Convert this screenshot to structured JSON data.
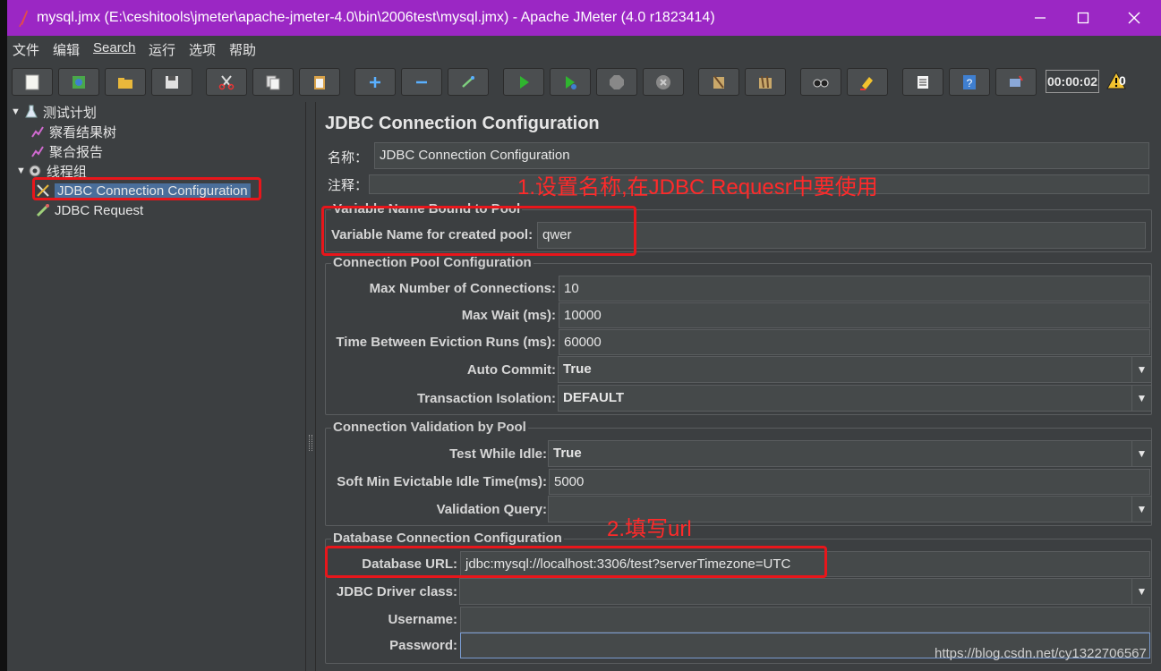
{
  "window": {
    "title": "mysql.jmx (E:\\ceshitools\\jmeter\\apache-jmeter-4.0\\bin\\2006test\\mysql.jmx) - Apache JMeter (4.0 r1823414)",
    "colors": {
      "titlebar": "#9b27c4",
      "background": "#3c3f41",
      "annotation": "#e8161b"
    }
  },
  "menu": [
    "文件",
    "编辑",
    "Search",
    "运行",
    "选项",
    "帮助"
  ],
  "toolbar": {
    "icons": [
      "new-icon",
      "templates-icon",
      "open-icon",
      "save-icon",
      "cut-icon",
      "copy-icon",
      "paste-icon",
      "expand-icon",
      "collapse-icon",
      "toggle-icon",
      "start-icon",
      "start-no-pause-icon",
      "stop-icon",
      "shutdown-icon",
      "clear-icon",
      "clear-all-icon",
      "search-icon",
      "reset-search-icon",
      "function-helper-icon",
      "help-icon",
      "remote-icon"
    ],
    "timer": "00:00:02",
    "warning_count": "0"
  },
  "tree": {
    "items": [
      {
        "label": "测试计划",
        "icon": "test-plan-icon"
      },
      {
        "label": "察看结果树",
        "icon": "listener-icon"
      },
      {
        "label": "聚合报告",
        "icon": "listener-icon"
      },
      {
        "label": "线程组",
        "icon": "thread-group-icon"
      },
      {
        "label": "JDBC Connection Configuration",
        "icon": "config-icon",
        "selected": true
      },
      {
        "label": "JDBC Request",
        "icon": "sampler-icon"
      }
    ]
  },
  "form": {
    "heading": "JDBC Connection Configuration",
    "name_label": "名称：",
    "name_value": "JDBC Connection Configuration",
    "comment_label": "注释：",
    "comment_value": "",
    "var_group_title": "Variable Name Bound to Pool",
    "var_label": "Variable Name for created pool:",
    "var_value": "qwer",
    "pool_group_title": "Connection Pool Configuration",
    "max_conn_label": "Max Number of Connections:",
    "max_conn_value": "10",
    "max_wait_label": "Max Wait (ms):",
    "max_wait_value": "10000",
    "eviction_label": "Time Between Eviction Runs (ms):",
    "eviction_value": "60000",
    "auto_commit_label": "Auto Commit:",
    "auto_commit_value": "True",
    "isolation_label": "Transaction Isolation:",
    "isolation_value": "DEFAULT",
    "validation_group_title": "Connection Validation by Pool",
    "test_idle_label": "Test While Idle:",
    "test_idle_value": "True",
    "soft_min_label": "Soft Min Evictable Idle Time(ms):",
    "soft_min_value": "5000",
    "validation_query_label": "Validation Query:",
    "validation_query_value": "",
    "db_group_title": "Database Connection Configuration",
    "db_url_label": "Database URL:",
    "db_url_value": "jdbc:mysql://localhost:3306/test?serverTimezone=UTC",
    "driver_label": "JDBC Driver class:",
    "driver_value": "",
    "username_label": "Username:",
    "username_value": "",
    "password_label": "Password:",
    "password_value": ""
  },
  "annotations": {
    "note1": "1.设置名称,在JDBC Requesr中要使用",
    "note2": "2.填写url"
  },
  "watermark": "https://blog.csdn.net/cy1322706567"
}
